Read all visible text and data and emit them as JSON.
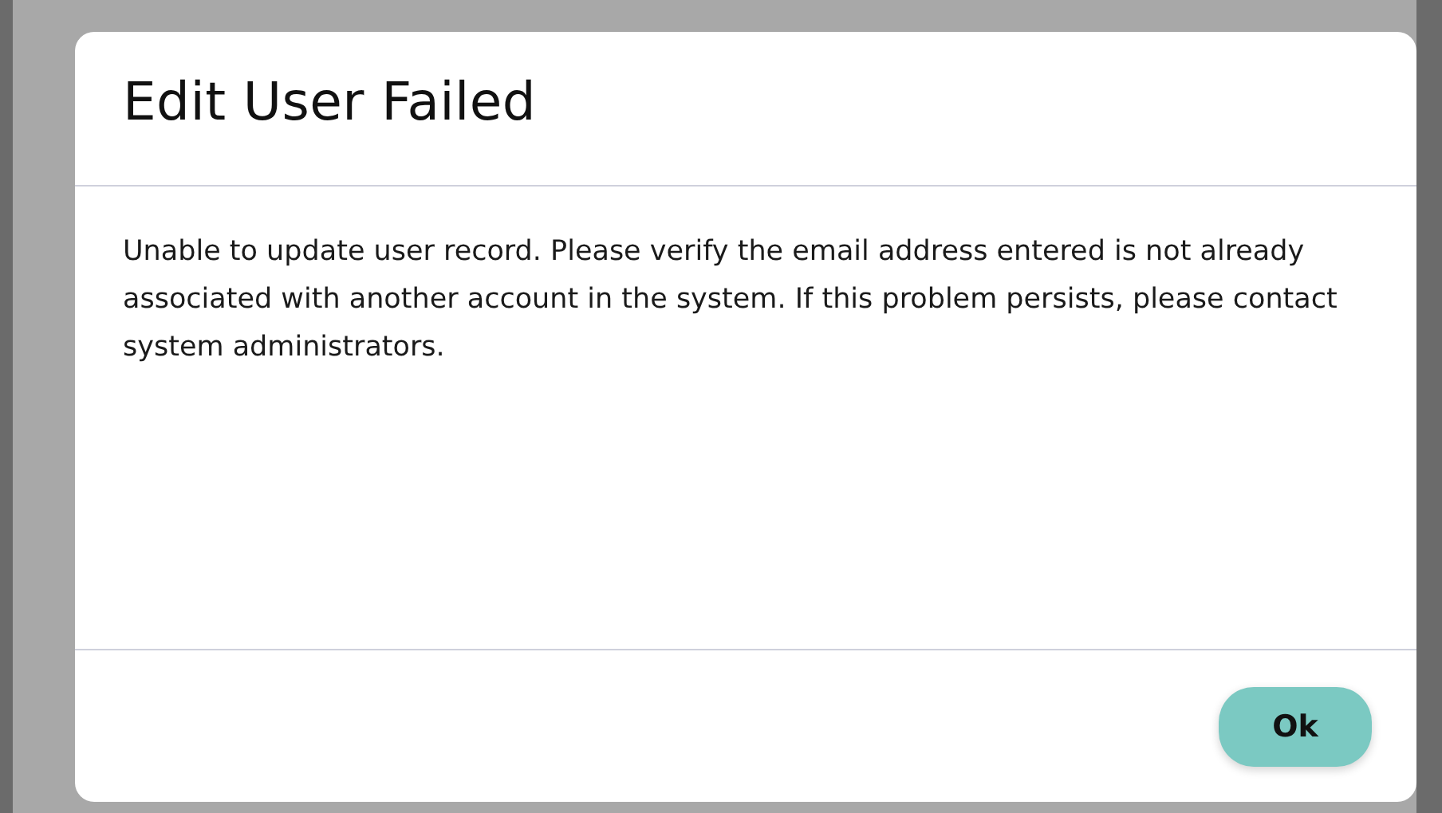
{
  "dialog": {
    "title": "Edit User Failed",
    "message": "Unable to update user record. Please verify the email address entered is not already associated with another account in the system. If this problem persists, please contact system administrators.",
    "buttons": [
      {
        "label": "Ok"
      }
    ]
  }
}
